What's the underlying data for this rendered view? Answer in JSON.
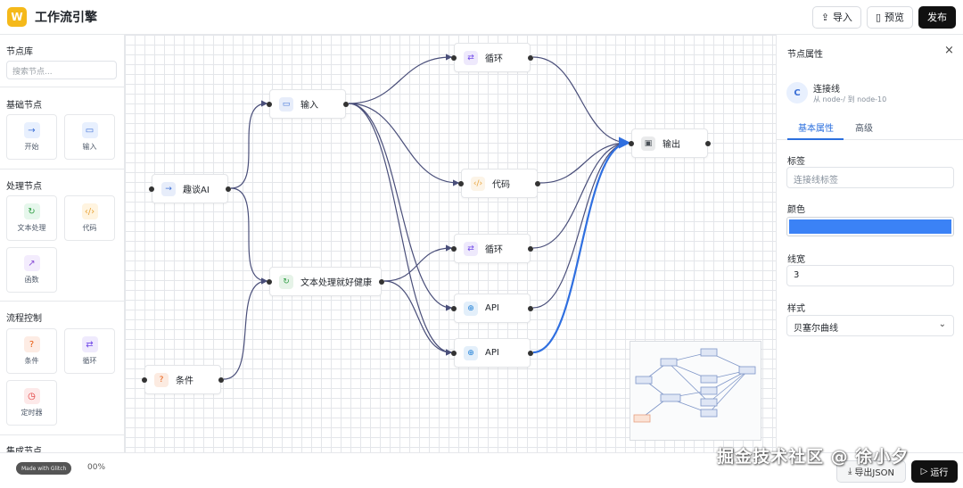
{
  "app": {
    "logo_letter": "W",
    "title": "工作流引擎"
  },
  "header": {
    "import": {
      "icon": "upload-icon",
      "label": "导入"
    },
    "preview": {
      "icon": "clipboard-icon",
      "label": "预览"
    },
    "publish": {
      "label": "发布"
    }
  },
  "sidebar": {
    "title": "节点库",
    "search_placeholder": "搜索节点...",
    "sections": [
      {
        "title": "基础节点",
        "items": [
          {
            "label": "开始",
            "icon": "arrow-right-icon",
            "color": "#3b6fd6"
          },
          {
            "label": "输入",
            "icon": "message-icon",
            "color": "#3b6fd6"
          }
        ]
      },
      {
        "title": "处理节点",
        "items": [
          {
            "label": "文本处理",
            "icon": "refresh-icon",
            "color": "#2f9e44"
          },
          {
            "label": "代码",
            "icon": "code-icon",
            "color": "#e8a33a"
          },
          {
            "label": "函数",
            "icon": "external-link-icon",
            "color": "#8a4fd6"
          }
        ]
      },
      {
        "title": "流程控制",
        "items": [
          {
            "label": "条件",
            "icon": "help-circle-icon",
            "color": "#e8590c"
          },
          {
            "label": "循环",
            "icon": "repeat-icon",
            "color": "#7048e8"
          },
          {
            "label": "定时器",
            "icon": "clock-icon",
            "color": "#e03131"
          }
        ]
      },
      {
        "title": "集成节点",
        "items": []
      }
    ]
  },
  "canvas": {
    "nodes": [
      {
        "id": "start",
        "label": "趣谈AI",
        "icon": "arrow-right-icon",
        "color": "#3b6fd6"
      },
      {
        "id": "input",
        "label": "输入",
        "icon": "message-icon",
        "color": "#3b6fd6"
      },
      {
        "id": "cond",
        "label": "条件",
        "icon": "help-circle-icon",
        "color": "#e8590c"
      },
      {
        "id": "text",
        "label": "文本处理就好健康",
        "icon": "refresh-icon",
        "color": "#2f9e44"
      },
      {
        "id": "loop1",
        "label": "循环",
        "icon": "repeat-icon",
        "color": "#7048e8"
      },
      {
        "id": "code",
        "label": "代码",
        "icon": "code-icon",
        "color": "#e8a33a"
      },
      {
        "id": "loop2",
        "label": "循环",
        "icon": "repeat-icon",
        "color": "#7048e8"
      },
      {
        "id": "api1",
        "label": "API",
        "icon": "globe-icon",
        "color": "#1c7ed6"
      },
      {
        "id": "api2",
        "label": "API",
        "icon": "globe-icon",
        "color": "#1c7ed6"
      },
      {
        "id": "output",
        "label": "输出",
        "icon": "image-icon",
        "color": "#495057"
      }
    ],
    "edges": [
      {
        "from": "start",
        "to": "input"
      },
      {
        "from": "start",
        "to": "text"
      },
      {
        "from": "cond",
        "to": "text"
      },
      {
        "from": "input",
        "to": "loop1"
      },
      {
        "from": "input",
        "to": "code"
      },
      {
        "from": "input",
        "to": "api1"
      },
      {
        "from": "input",
        "to": "api2"
      },
      {
        "from": "text",
        "to": "loop2"
      },
      {
        "from": "text",
        "to": "api2"
      },
      {
        "from": "loop1",
        "to": "output"
      },
      {
        "from": "code",
        "to": "output"
      },
      {
        "from": "loop2",
        "to": "output"
      },
      {
        "from": "api1",
        "to": "output"
      },
      {
        "from": "api2",
        "to": "output",
        "selected": true
      }
    ],
    "edge_color": "#4a4f7a",
    "selected_edge_color": "#2f6fe0"
  },
  "bottom": {
    "made_with": "Made with Glitch",
    "zoom_text": "00%",
    "export_label": "导出JSON",
    "run_label": "运行"
  },
  "panel": {
    "title": "节点属性",
    "close_icon": "close-icon",
    "avatar_letter": "C",
    "connection_title": "连接线",
    "connection_sub": "从 node-/ 到 node-10",
    "tabs": [
      "基本属性",
      "高级"
    ],
    "label_field": {
      "label": "标签",
      "placeholder": "连接线标签"
    },
    "color_field": {
      "label": "颜色",
      "value": "#3b82f6"
    },
    "width_field": {
      "label": "线宽",
      "value": "3"
    },
    "style_field": {
      "label": "样式",
      "value": "贝塞尔曲线"
    }
  },
  "watermark": "掘金技术社区 @ 徐小夕"
}
